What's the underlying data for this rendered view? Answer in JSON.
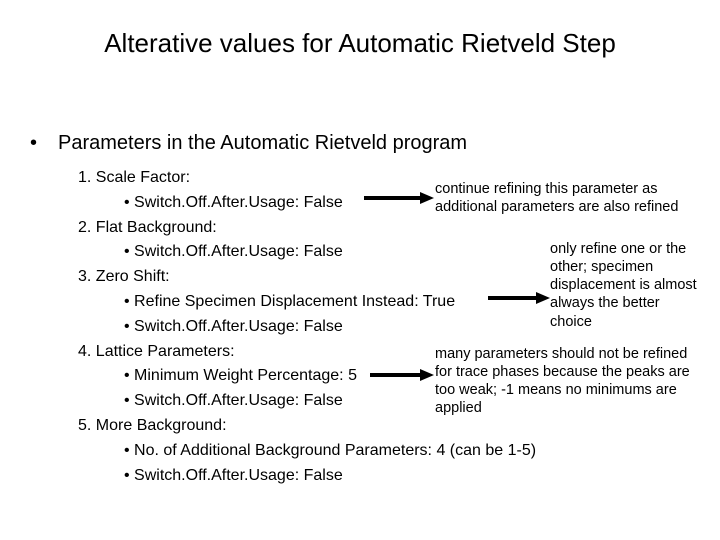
{
  "title": "Alterative values for Automatic Rietveld Step",
  "top_bullet": "Parameters in the Automatic Rietveld program",
  "items": {
    "n1": "1.  Scale Factor:",
    "n1a": "•   Switch.Off.After.Usage: False",
    "n2": "2.  Flat Background:",
    "n2a": "•   Switch.Off.After.Usage: False",
    "n3": "3.  Zero Shift:",
    "n3a": "•   Refine Specimen Displacement Instead: True",
    "n3b": "•   Switch.Off.After.Usage: False",
    "n4": "4.  Lattice Parameters:",
    "n4a": "•   Minimum Weight Percentage: 5",
    "n4b": "•   Switch.Off.After.Usage: False",
    "n5": "5.  More Background:",
    "n5a": "•   No. of Additional Background Parameters: 4 (can be 1-5)",
    "n5b": "•   Switch.Off.After.Usage: False"
  },
  "notes": {
    "a": "continue refining this parameter as additional parameters are also refined",
    "b": "only refine one or the other; specimen displacement is almost always the better choice",
    "c": "many parameters should not be refined for trace phases because the peaks are too weak; -1 means no minimums are applied"
  }
}
